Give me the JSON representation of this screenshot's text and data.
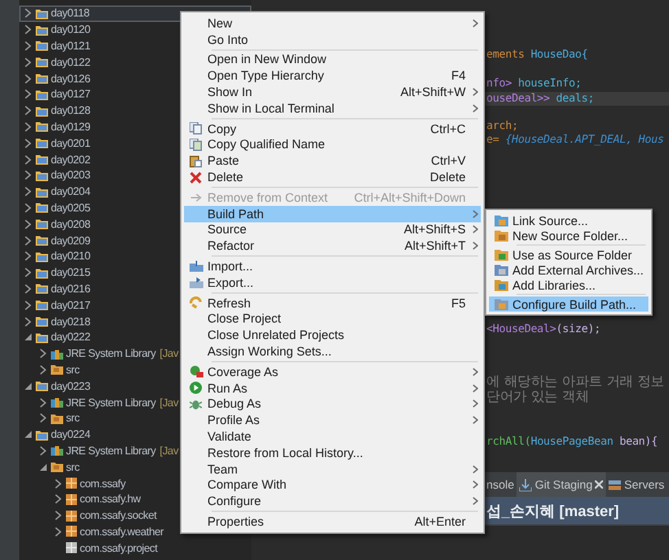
{
  "tree": [
    {
      "label": "day0118",
      "selected": true,
      "expanded": false
    },
    {
      "label": "day0120",
      "selected": false,
      "expanded": false
    },
    {
      "label": "day0121",
      "selected": false,
      "expanded": false
    },
    {
      "label": "day0122",
      "selected": false,
      "expanded": false
    },
    {
      "label": "day0126",
      "selected": false,
      "expanded": false
    },
    {
      "label": "day0127",
      "selected": false,
      "expanded": false
    },
    {
      "label": "day0128",
      "selected": false,
      "expanded": false
    },
    {
      "label": "day0129",
      "selected": false,
      "expanded": false
    },
    {
      "label": "day0201",
      "selected": false,
      "expanded": false
    },
    {
      "label": "day0202",
      "selected": false,
      "expanded": false
    },
    {
      "label": "day0203",
      "selected": false,
      "expanded": false
    },
    {
      "label": "day0204",
      "selected": false,
      "expanded": false
    },
    {
      "label": "day0205",
      "selected": false,
      "expanded": false
    },
    {
      "label": "day0208",
      "selected": false,
      "expanded": false
    },
    {
      "label": "day0209",
      "selected": false,
      "expanded": false
    },
    {
      "label": "day0210",
      "selected": false,
      "expanded": false
    },
    {
      "label": "day0215",
      "selected": false,
      "expanded": false
    },
    {
      "label": "day0216",
      "selected": false,
      "expanded": false
    },
    {
      "label": "day0217",
      "selected": false,
      "expanded": false
    },
    {
      "label": "day0218",
      "selected": false,
      "expanded": false
    },
    {
      "label": "day0222",
      "selected": false,
      "expanded": true,
      "children": [
        {
          "kind": "library",
          "label": "JRE System Library",
          "decoration": "[Jav",
          "expanded": false
        },
        {
          "kind": "source",
          "label": "src",
          "expanded": false
        }
      ]
    },
    {
      "label": "day0223",
      "selected": false,
      "expanded": true,
      "children": [
        {
          "kind": "library",
          "label": "JRE System Library",
          "decoration": "[Jav",
          "expanded": false
        },
        {
          "kind": "source",
          "label": "src",
          "expanded": false
        }
      ]
    },
    {
      "label": "day0224",
      "selected": false,
      "expanded": true,
      "children": [
        {
          "kind": "library",
          "label": "JRE System Library",
          "decoration": "[Jav",
          "expanded": false
        },
        {
          "kind": "source",
          "label": "src",
          "expanded": true,
          "children": [
            {
              "kind": "package",
              "label": "com.ssafy",
              "expanded": false
            },
            {
              "kind": "package",
              "label": "com.ssafy.hw",
              "expanded": false
            },
            {
              "kind": "package",
              "label": "com.ssafy.socket",
              "expanded": false
            },
            {
              "kind": "package",
              "label": "com.ssafy.weather",
              "expanded": false
            },
            {
              "kind": "empty-package",
              "label": "com.ssafy.project"
            }
          ]
        }
      ]
    }
  ],
  "code": [
    {
      "highlighted": false,
      "tokens": [
        {
          "kind": "keyword",
          "text": "ements"
        },
        {
          "kind": "type",
          "text": " HouseDao{"
        }
      ]
    },
    {
      "highlighted": false,
      "tokens": [
        {
          "kind": "generic",
          "text": "nfo>"
        },
        {
          "kind": "field",
          "text": " houseInfo;"
        }
      ]
    },
    {
      "highlighted": true,
      "tokens": [
        {
          "kind": "generic",
          "text": "ouseDeal>>"
        },
        {
          "kind": "field",
          "text": " deals;"
        }
      ]
    },
    {
      "highlighted": false,
      "tokens": [
        {
          "kind": "keyword",
          "text": "arch;"
        }
      ]
    },
    {
      "highlighted": false,
      "tokens": [
        {
          "kind": "keyword",
          "text": "e="
        },
        {
          "kind": "constant",
          "text": " {HouseDeal.APT_DEAL, Hous"
        }
      ]
    },
    {
      "highlighted": false,
      "tokens": [
        {
          "kind": "generic",
          "text": "<HouseDeal>"
        },
        {
          "kind": "plain",
          "text": "(size);"
        }
      ]
    },
    {
      "highlighted": false,
      "tokens": [
        {
          "kind": "comment",
          "text": "에 해당하는 아파트 거래 정보"
        }
      ]
    },
    {
      "highlighted": false,
      "tokens": [
        {
          "kind": "comment",
          "text": "단어가 있는 객체"
        }
      ]
    },
    {
      "highlighted": false,
      "tokens": [
        {
          "kind": "method",
          "text": "rchAll("
        },
        {
          "kind": "type",
          "text": "HousePageBean"
        },
        {
          "kind": "plain",
          "text": "  bean){"
        }
      ]
    }
  ],
  "bottom_tabs": [
    {
      "label": "nsole",
      "selected": false
    },
    {
      "label": "Git Staging",
      "selected": true
    },
    {
      "label": "Servers",
      "selected": false
    }
  ],
  "staging_title": "섭_손지혜 [master]",
  "menu": [
    [
      {
        "label": "New",
        "submenu": true,
        "disabled": false,
        "highlighted": false
      },
      {
        "label": "Go Into",
        "submenu": false,
        "disabled": false,
        "highlighted": false
      }
    ],
    [
      {
        "label": "Open in New Window",
        "submenu": false,
        "disabled": false,
        "highlighted": false
      },
      {
        "label": "Open Type Hierarchy",
        "shortcut": "F4",
        "submenu": false,
        "disabled": false,
        "highlighted": false
      },
      {
        "label": "Show In",
        "shortcut": "Alt+Shift+W",
        "submenu": true,
        "disabled": false,
        "highlighted": false
      },
      {
        "label": "Show in Local Terminal",
        "submenu": true,
        "disabled": false,
        "highlighted": false
      }
    ],
    [
      {
        "label": "Copy",
        "shortcut": "Ctrl+C",
        "submenu": false,
        "disabled": false,
        "highlighted": false
      },
      {
        "label": "Copy Qualified Name",
        "submenu": false,
        "disabled": false,
        "highlighted": false
      },
      {
        "label": "Paste",
        "shortcut": "Ctrl+V",
        "submenu": false,
        "disabled": false,
        "highlighted": false
      },
      {
        "label": "Delete",
        "shortcut": "Delete",
        "submenu": false,
        "disabled": false,
        "highlighted": false
      }
    ],
    [
      {
        "label": "Remove from Context",
        "shortcut": "Ctrl+Alt+Shift+Down",
        "submenu": false,
        "disabled": true,
        "highlighted": false
      },
      {
        "label": "Build Path",
        "submenu": true,
        "disabled": false,
        "highlighted": true
      },
      {
        "label": "Source",
        "shortcut": "Alt+Shift+S",
        "submenu": true,
        "disabled": false,
        "highlighted": false
      },
      {
        "label": "Refactor",
        "shortcut": "Alt+Shift+T",
        "submenu": true,
        "disabled": false,
        "highlighted": false
      }
    ],
    [
      {
        "label": "Import...",
        "submenu": false,
        "disabled": false,
        "highlighted": false
      },
      {
        "label": "Export...",
        "submenu": false,
        "disabled": false,
        "highlighted": false
      }
    ],
    [
      {
        "label": "Refresh",
        "shortcut": "F5",
        "submenu": false,
        "disabled": false,
        "highlighted": false
      },
      {
        "label": "Close Project",
        "submenu": false,
        "disabled": false,
        "highlighted": false
      },
      {
        "label": "Close Unrelated Projects",
        "submenu": false,
        "disabled": false,
        "highlighted": false
      },
      {
        "label": "Assign Working Sets...",
        "submenu": false,
        "disabled": false,
        "highlighted": false
      }
    ],
    [
      {
        "label": "Coverage As",
        "submenu": true,
        "disabled": false,
        "highlighted": false
      },
      {
        "label": "Run As",
        "submenu": true,
        "disabled": false,
        "highlighted": false
      },
      {
        "label": "Debug As",
        "submenu": true,
        "disabled": false,
        "highlighted": false
      },
      {
        "label": "Profile As",
        "submenu": true,
        "disabled": false,
        "highlighted": false
      },
      {
        "label": "Validate",
        "submenu": false,
        "disabled": false,
        "highlighted": false
      },
      {
        "label": "Restore from Local History...",
        "submenu": false,
        "disabled": false,
        "highlighted": false
      },
      {
        "label": "Team",
        "submenu": true,
        "disabled": false,
        "highlighted": false
      },
      {
        "label": "Compare With",
        "submenu": true,
        "disabled": false,
        "highlighted": false
      },
      {
        "label": "Configure",
        "submenu": true,
        "disabled": false,
        "highlighted": false
      }
    ],
    [
      {
        "label": "Properties",
        "shortcut": "Alt+Enter",
        "submenu": false,
        "disabled": false,
        "highlighted": false
      }
    ]
  ],
  "submenu": [
    [
      {
        "label": "Link Source...",
        "highlighted": false
      },
      {
        "label": "New Source Folder...",
        "highlighted": false
      }
    ],
    [
      {
        "label": "Use as Source Folder",
        "highlighted": false
      },
      {
        "label": "Add External Archives...",
        "highlighted": false
      },
      {
        "label": "Add Libraries...",
        "highlighted": false
      }
    ],
    [
      {
        "label": "Configure Build Path...",
        "highlighted": true
      }
    ]
  ]
}
